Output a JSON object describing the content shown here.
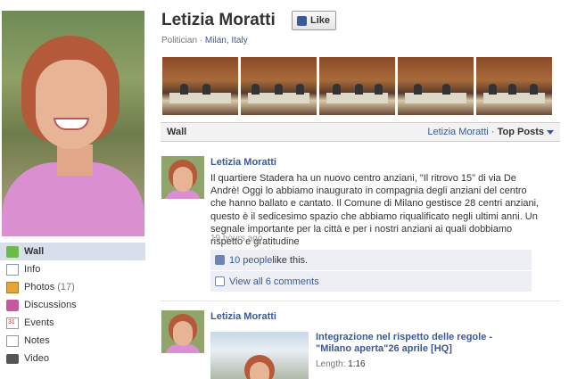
{
  "profile": {
    "name": "Letizia Moratti",
    "like_label": "Like",
    "category": "Politician",
    "separator": " · ",
    "location": "Milan, Italy"
  },
  "nav": {
    "items": [
      {
        "label": "Wall",
        "icon": "wall-icon",
        "active": true
      },
      {
        "label": "Info",
        "icon": "info-icon"
      },
      {
        "label": "Photos",
        "icon": "photos-icon",
        "count": "(17)"
      },
      {
        "label": "Discussions",
        "icon": "discussions-icon"
      },
      {
        "label": "Events",
        "icon": "events-icon"
      },
      {
        "label": "Notes",
        "icon": "notes-icon"
      },
      {
        "label": "Video",
        "icon": "video-icon"
      }
    ]
  },
  "wall": {
    "title": "Wall",
    "filter_author": "Letizia Moratti",
    "filter_separator": " · ",
    "filter_option": "Top Posts"
  },
  "posts": [
    {
      "author": "Letizia Moratti",
      "text": "Il quartiere Stadera ha un nuovo centro anziani, \"Il ritrovo 15\" di via De Andrè! Oggi lo abbiamo inaugurato in compagnia degli anziani del centro che hanno ballato e cantato. Il Comune di Milano gestisce 28 centri anziani, questo è il sedicesimo spazio che abbiamo riqualificato negli ultimi anni. Un segnale importante per la città e per i nostri anziani ai quali dobbiamo rispetto e gratitudine",
      "time": "19 hours ago",
      "likes_link": "10 people",
      "likes_suffix": " like this.",
      "comments_link": "View all 6 comments"
    },
    {
      "author": "Letizia Moratti",
      "video_title": "Integrazione nel rispetto delle regole - \"Milano aperta\"26 aprile [HQ]",
      "length_label": "Length:",
      "length_value": "1:16"
    }
  ],
  "colors": {
    "link": "#3b5998",
    "nav_active_bg": "#d8dfea",
    "feedback_bg": "#edeff4"
  }
}
